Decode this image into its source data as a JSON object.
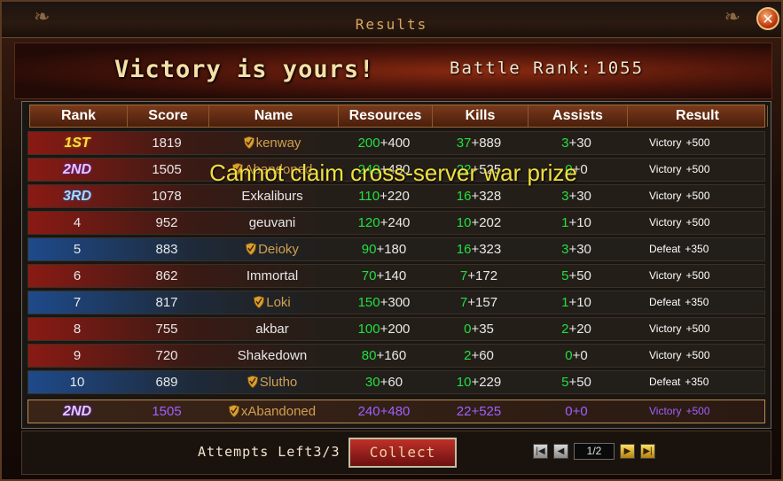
{
  "window": {
    "title": "Results",
    "close_label": "✕"
  },
  "banner": {
    "headline": "Victory is yours!",
    "battle_rank_label": "Battle Rank:",
    "battle_rank_value": "1055"
  },
  "columns": [
    "Rank",
    "Score",
    "Name",
    "Resources",
    "Kills",
    "Assists",
    "Result"
  ],
  "rows": [
    {
      "rank": "1ST",
      "badge": "r1",
      "score": "1819",
      "name": "kenway",
      "guild": true,
      "res_a": "200",
      "res_b": "+400",
      "kills_a": "37",
      "kills_b": "+889",
      "assist_a": "3",
      "assist_b": "+30",
      "result": "Victory",
      "result_bonus": "+500",
      "side": "red"
    },
    {
      "rank": "2ND",
      "badge": "r2",
      "score": "1505",
      "name": "Abandoned",
      "guild": true,
      "res_a": "240",
      "res_b": "+480",
      "kills_a": "22",
      "kills_b": "+525",
      "assist_a": "0",
      "assist_b": "+0",
      "result": "Victory",
      "result_bonus": "+500",
      "side": "red"
    },
    {
      "rank": "3RD",
      "badge": "r3",
      "score": "1078",
      "name": "Exkaliburs",
      "guild": false,
      "res_a": "110",
      "res_b": "+220",
      "kills_a": "16",
      "kills_b": "+328",
      "assist_a": "3",
      "assist_b": "+30",
      "result": "Victory",
      "result_bonus": "+500",
      "side": "red"
    },
    {
      "rank": "4",
      "badge": "",
      "score": "952",
      "name": "geuvani",
      "guild": false,
      "res_a": "120",
      "res_b": "+240",
      "kills_a": "10",
      "kills_b": "+202",
      "assist_a": "1",
      "assist_b": "+10",
      "result": "Victory",
      "result_bonus": "+500",
      "side": "red"
    },
    {
      "rank": "5",
      "badge": "",
      "score": "883",
      "name": "Deioky",
      "guild": true,
      "res_a": "90",
      "res_b": "+180",
      "kills_a": "16",
      "kills_b": "+323",
      "assist_a": "3",
      "assist_b": "+30",
      "result": "Defeat",
      "result_bonus": "+350",
      "side": "blue"
    },
    {
      "rank": "6",
      "badge": "",
      "score": "862",
      "name": "Immortal",
      "guild": false,
      "res_a": "70",
      "res_b": "+140",
      "kills_a": "7",
      "kills_b": "+172",
      "assist_a": "5",
      "assist_b": "+50",
      "result": "Victory",
      "result_bonus": "+500",
      "side": "red"
    },
    {
      "rank": "7",
      "badge": "",
      "score": "817",
      "name": "Loki",
      "guild": true,
      "res_a": "150",
      "res_b": "+300",
      "kills_a": "7",
      "kills_b": "+157",
      "assist_a": "1",
      "assist_b": "+10",
      "result": "Defeat",
      "result_bonus": "+350",
      "side": "blue"
    },
    {
      "rank": "8",
      "badge": "",
      "score": "755",
      "name": "akbar",
      "guild": false,
      "res_a": "100",
      "res_b": "+200",
      "kills_a": "0",
      "kills_b": "+35",
      "assist_a": "2",
      "assist_b": "+20",
      "result": "Victory",
      "result_bonus": "+500",
      "side": "red"
    },
    {
      "rank": "9",
      "badge": "",
      "score": "720",
      "name": "Shakedown",
      "guild": false,
      "res_a": "80",
      "res_b": "+160",
      "kills_a": "2",
      "kills_b": "+60",
      "assist_a": "0",
      "assist_b": "+0",
      "result": "Victory",
      "result_bonus": "+500",
      "side": "red"
    },
    {
      "rank": "10",
      "badge": "",
      "score": "689",
      "name": "Slutho",
      "guild": true,
      "res_a": "30",
      "res_b": "+60",
      "kills_a": "10",
      "kills_b": "+229",
      "assist_a": "5",
      "assist_b": "+50",
      "result": "Defeat",
      "result_bonus": "+350",
      "side": "blue"
    }
  ],
  "my_row": {
    "rank": "2ND",
    "badge": "r2",
    "score": "1505",
    "name": "xAbandoned",
    "guild": true,
    "res_a": "240",
    "res_b": "+480",
    "kills_a": "22",
    "kills_b": "+525",
    "assist_a": "0",
    "assist_b": "+0",
    "result": "Victory",
    "result_bonus": "+500"
  },
  "overlay_message": "Cannot claim cross-server war prize",
  "footer": {
    "attempts_label": "Attempts Left",
    "attempts_value": "3/3",
    "collect_label": "Collect",
    "page": "1/2"
  },
  "colors": {
    "victory_side": "#8a1a14",
    "defeat_side": "#1e4a8a",
    "green_value": "#20e040",
    "guild_name": "#d0a050",
    "self_row": "#a060ff"
  }
}
